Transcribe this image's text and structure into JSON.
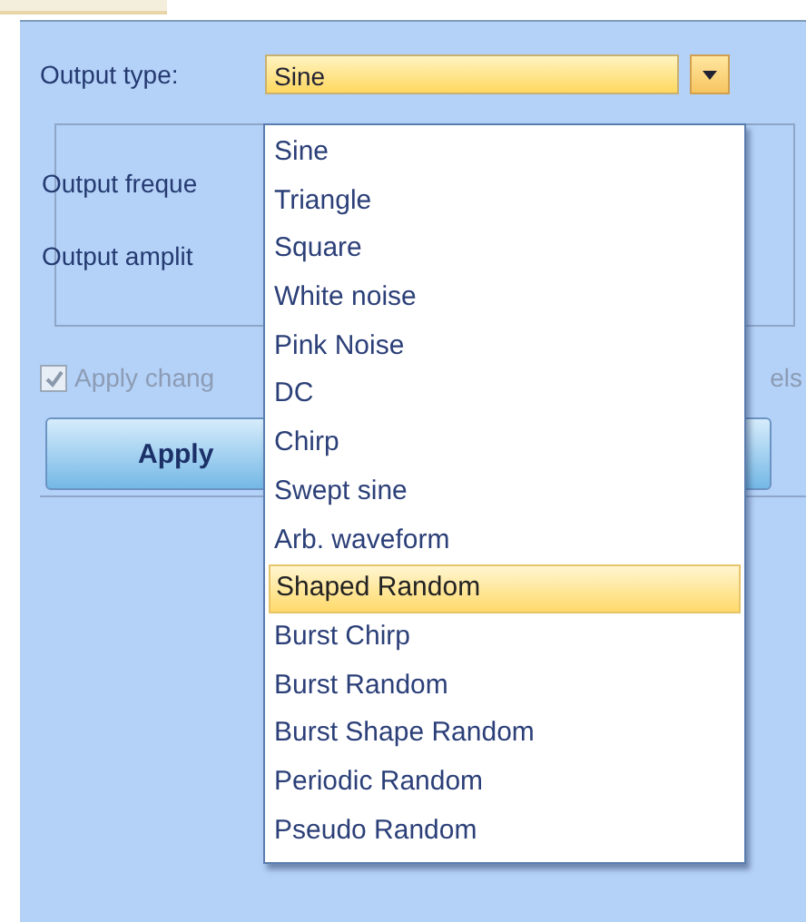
{
  "output_type": {
    "label": "Output type:",
    "value": "Sine",
    "expanded": true
  },
  "group": {
    "frequency_label": "Output freque",
    "amplitude_label": "Output amplit"
  },
  "apply_changes": {
    "label": "Apply chang",
    "label_end": "els",
    "checked": true,
    "disabled": true
  },
  "apply_button": {
    "label": "Apply"
  },
  "options": [
    {
      "label": "Sine",
      "selected": false
    },
    {
      "label": "Triangle",
      "selected": false
    },
    {
      "label": "Square",
      "selected": false
    },
    {
      "label": "White noise",
      "selected": false
    },
    {
      "label": "Pink Noise",
      "selected": false
    },
    {
      "label": "DC",
      "selected": false
    },
    {
      "label": "Chirp",
      "selected": false
    },
    {
      "label": "Swept sine",
      "selected": false
    },
    {
      "label": "Arb. waveform",
      "selected": false
    },
    {
      "label": "Shaped Random",
      "selected": true
    },
    {
      "label": "Burst Chirp",
      "selected": false
    },
    {
      "label": "Burst Random",
      "selected": false
    },
    {
      "label": "Burst Shape Random",
      "selected": false
    },
    {
      "label": "Periodic Random",
      "selected": false
    },
    {
      "label": "Pseudo Random",
      "selected": false
    }
  ]
}
